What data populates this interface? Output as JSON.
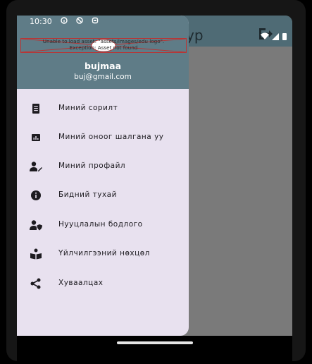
{
  "status_bar": {
    "time": "10:30"
  },
  "behind": {
    "title_fragment": "ур"
  },
  "drawer": {
    "header": {
      "asset_error_line1": "Unable to load asset: \"assets/images/edu logo\".",
      "asset_error_line2": "Exception: Asset not found",
      "user_name": "bujmaa",
      "user_email": "buj@gmail.com"
    },
    "items": [
      {
        "label": "Миний сорилт",
        "icon": "clipboard-icon"
      },
      {
        "label": "Миний оноог шалгана уу",
        "icon": "score-chart-icon"
      },
      {
        "label": "Миний профайл",
        "icon": "edit-profile-icon"
      },
      {
        "label": "Бидний тухай",
        "icon": "info-icon"
      },
      {
        "label": "Нууцлалын бодлого",
        "icon": "privacy-shield-icon"
      },
      {
        "label": "Үйлчилгээний нөхцөл",
        "icon": "terms-book-icon"
      },
      {
        "label": "Хуваалцах",
        "icon": "share-icon"
      }
    ]
  },
  "colors": {
    "header_bg": "#5f7c87",
    "drawer_bg": "#e8e1ef",
    "scrim": "#7a7a7a",
    "error_border": "#b83535"
  }
}
